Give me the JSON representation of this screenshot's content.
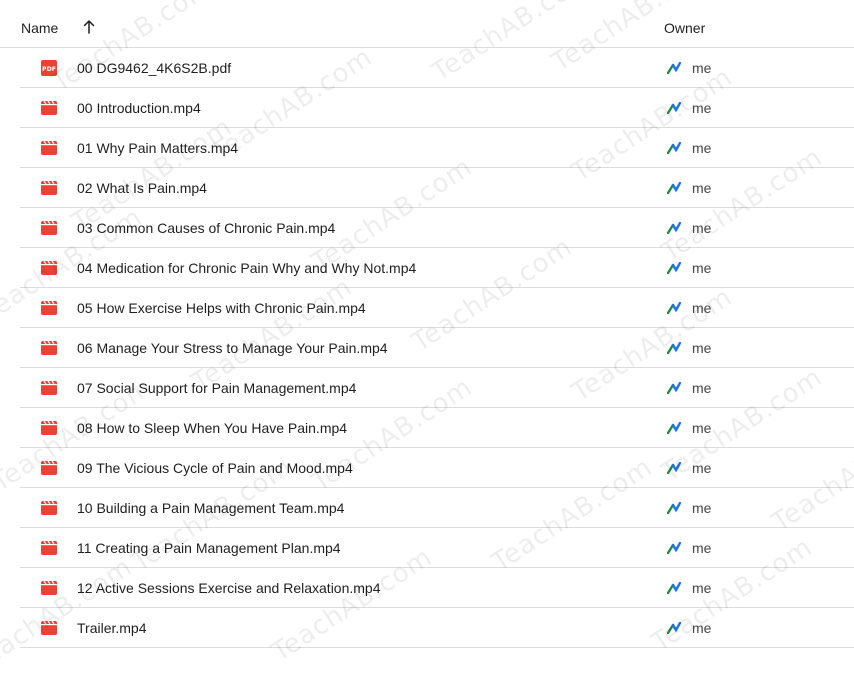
{
  "header": {
    "name_label": "Name",
    "sort_icon": "arrow-up-icon",
    "owner_label": "Owner"
  },
  "files": [
    {
      "name": "00 DG9462_4K6S2B.pdf",
      "icon": "pdf-icon",
      "owner": "me"
    },
    {
      "name": "00 Introduction.mp4",
      "icon": "video-icon",
      "owner": "me"
    },
    {
      "name": "01 Why Pain Matters.mp4",
      "icon": "video-icon",
      "owner": "me"
    },
    {
      "name": "02 What Is Pain.mp4",
      "icon": "video-icon",
      "owner": "me"
    },
    {
      "name": "03 Common Causes of Chronic Pain.mp4",
      "icon": "video-icon",
      "owner": "me"
    },
    {
      "name": "04 Medication for Chronic Pain Why and Why Not.mp4",
      "icon": "video-icon",
      "owner": "me"
    },
    {
      "name": "05 How Exercise Helps with Chronic Pain.mp4",
      "icon": "video-icon",
      "owner": "me"
    },
    {
      "name": "06 Manage Your Stress to Manage Your Pain.mp4",
      "icon": "video-icon",
      "owner": "me"
    },
    {
      "name": "07 Social Support for Pain Management.mp4",
      "icon": "video-icon",
      "owner": "me"
    },
    {
      "name": "08 How to Sleep When You Have Pain.mp4",
      "icon": "video-icon",
      "owner": "me"
    },
    {
      "name": "09 The Vicious Cycle of Pain and Mood.mp4",
      "icon": "video-icon",
      "owner": "me"
    },
    {
      "name": "10 Building a Pain Management Team.mp4",
      "icon": "video-icon",
      "owner": "me"
    },
    {
      "name": "11 Creating a Pain Management Plan.mp4",
      "icon": "video-icon",
      "owner": "me"
    },
    {
      "name": "12 Active Sessions Exercise and Relaxation.mp4",
      "icon": "video-icon",
      "owner": "me"
    },
    {
      "name": "Trailer.mp4",
      "icon": "video-icon",
      "owner": "me"
    }
  ],
  "watermark_text": "TeachAB.com",
  "colors": {
    "file_icon_red": "#ea4335",
    "owner_icon_green": "#1e8e3e",
    "owner_icon_blue": "#1a73e8",
    "divider": "#dadce0"
  }
}
